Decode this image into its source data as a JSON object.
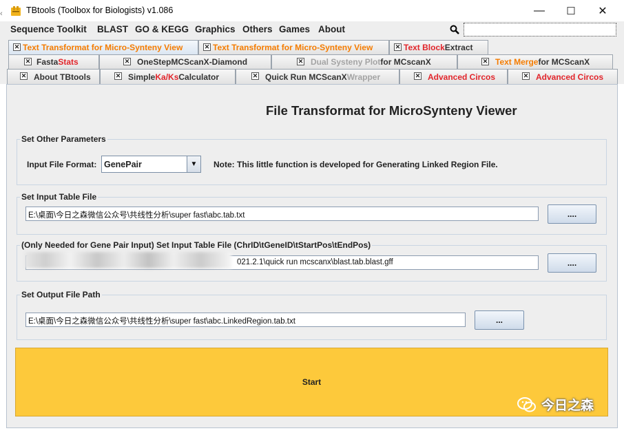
{
  "window": {
    "title": "TBtools (Toolbox for Biologists) v1.086",
    "controls": {
      "minimize": "—",
      "maximize": "☐",
      "close": "✕"
    }
  },
  "menu": {
    "items": [
      "Sequence Toolkit",
      "BLAST",
      "GO & KEGG",
      "Graphics",
      "Others",
      "Games",
      "About"
    ],
    "search_icon": "search-icon",
    "search_value": ""
  },
  "tabs": {
    "row1": [
      {
        "label": "Text Transformat for Micro-Synteny View",
        "style": "orange",
        "selected": true
      },
      {
        "label": "Text Transformat for Micro-Synteny View",
        "style": "orange"
      },
      {
        "label_a": "Text Block",
        "label_b": " Extract",
        "style": "mixed-red"
      }
    ],
    "row2": [
      {
        "label_a": "Fasta ",
        "label_b": "Stats"
      },
      {
        "label": "OneStepMCScanX-Diamond"
      },
      {
        "label_a": "Dual Systeny Plot",
        "label_b": " for MCscanX"
      },
      {
        "label_a": "Text Merge",
        "label_b": " for MCScanX"
      }
    ],
    "row3": [
      {
        "label": "About TBtools"
      },
      {
        "label_a": "Simple ",
        "label_b": "Ka/Ks",
        "label_c": " Calculator"
      },
      {
        "label_a": "Quick Run MCScanX ",
        "label_b": "Wrapper"
      },
      {
        "label": "Advanced Circos"
      },
      {
        "label": "Advanced Circos"
      }
    ]
  },
  "main": {
    "title": "File Transformat for MicroSynteny Viewer",
    "other_params": {
      "group_label": "Set Other Parameters",
      "format_label": "Input File Format:",
      "format_value": "GenePair",
      "note": "Note: This little function is developed for Generating Linked Region File."
    },
    "input_table": {
      "group_label": "Set Input Table File",
      "value": "E:\\桌面\\今日之森微信公众号\\共线性分析\\super fast\\abc.tab.txt",
      "button": "...."
    },
    "gene_pair_table": {
      "group_label": "(Only Needed for Gene Pair Input) Set Input Table File (ChrID\\tGeneID\\tStartPos\\tEndPos)",
      "value": "021.2.1\\quick run mcscanx\\blast.tab.blast.gff",
      "button": "...."
    },
    "output": {
      "group_label": "Set Output File Path",
      "value": "E:\\桌面\\今日之森微信公众号\\共线性分析\\super fast\\abc.LinkedRegion.tab.txt",
      "button": "..."
    },
    "start_button": "Start"
  },
  "watermark": "今日之森",
  "colors": {
    "accent_orange": "#f57c00",
    "accent_red": "#e2252b",
    "start_yellow": "#fdc93b"
  }
}
